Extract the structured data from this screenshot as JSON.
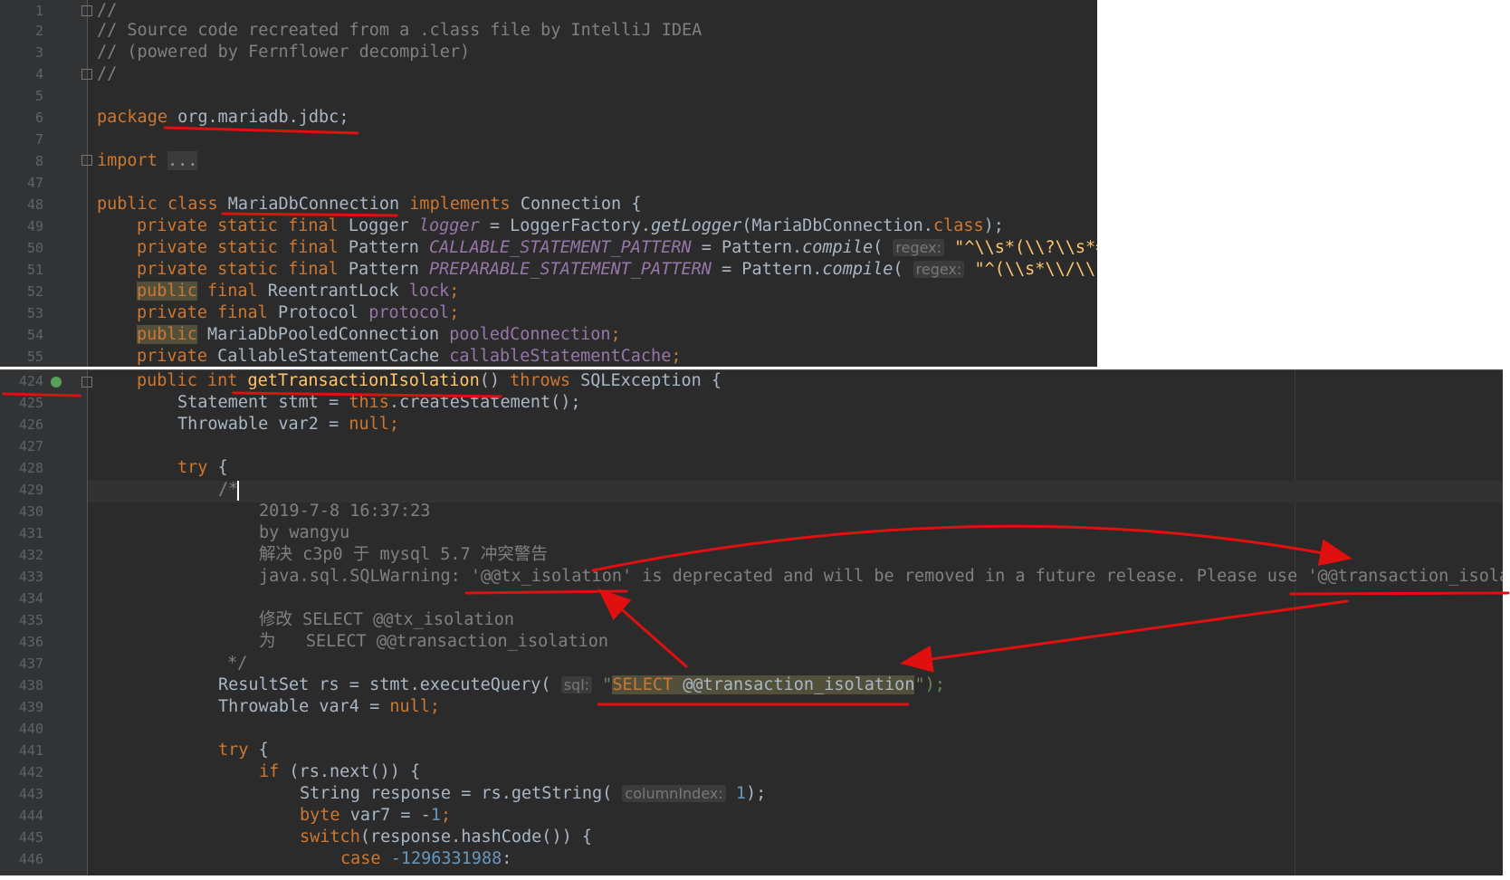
{
  "top_panel": {
    "lines": [
      {
        "n": "1",
        "t": "//"
      },
      {
        "n": "2",
        "t": "// Source code recreated from a .class file by IntelliJ IDEA"
      },
      {
        "n": "3",
        "t": "// (powered by Fernflower decompiler)"
      },
      {
        "n": "4",
        "t": "//"
      },
      {
        "n": "5",
        "t": ""
      },
      {
        "n": "6",
        "kw": "package ",
        "rest": "org.mariadb.jdbc;"
      },
      {
        "n": "7",
        "t": ""
      },
      {
        "n": "8",
        "kw": "import ",
        "rest": "..."
      },
      {
        "n": "47",
        "t": ""
      },
      {
        "n": "48",
        "a": "public class ",
        "b": "MariaDbConnection",
        "c": " implements ",
        "d": "Connection {"
      },
      {
        "n": "49",
        "a": "private static final ",
        "b": "Logger ",
        "c": "logger",
        "d": " = LoggerFactory.",
        "e": "getLogger",
        "f": "(MariaDbConnection.",
        "g": "class",
        "h": ");"
      },
      {
        "n": "50",
        "a": "private static final ",
        "b": "Pattern ",
        "c": "CALLABLE_STATEMENT_PATTERN",
        "d": " = Pattern.",
        "e": "compile",
        "f": "( ",
        "hint": "regex:",
        "g": " \"^\\\\s*(\\\\?\\\\s*=)"
      },
      {
        "n": "51",
        "a": "private static final ",
        "b": "Pattern ",
        "c": "PREPARABLE_STATEMENT_PATTERN",
        "d": " = Pattern.",
        "e": "compile",
        "f": "( ",
        "hint": "regex:",
        "g": " \"^(\\\\s*\\\\/\\\\*("
      },
      {
        "n": "52",
        "a": "public",
        "b": " final ",
        "c": "ReentrantLock ",
        "d": "lock",
        "e": ";"
      },
      {
        "n": "53",
        "a": "private final ",
        "c": "Protocol ",
        "d": "protocol",
        "e": ";"
      },
      {
        "n": "54",
        "a": "public",
        "c": " MariaDbPooledConnection ",
        "d": "pooledConnection",
        "e": ";"
      },
      {
        "n": "55",
        "a": "private ",
        "c": "CallableStatementCache ",
        "d": "callableStatementCache",
        "e": ";"
      }
    ]
  },
  "bottom_panel": {
    "lines": [
      {
        "n": "424"
      },
      {
        "n": "425"
      },
      {
        "n": "426"
      },
      {
        "n": "427"
      },
      {
        "n": "428"
      },
      {
        "n": "429"
      },
      {
        "n": "430"
      },
      {
        "n": "431"
      },
      {
        "n": "432"
      },
      {
        "n": "433"
      },
      {
        "n": "434"
      },
      {
        "n": "435"
      },
      {
        "n": "436"
      },
      {
        "n": "437"
      },
      {
        "n": "438"
      },
      {
        "n": "439"
      },
      {
        "n": "440"
      },
      {
        "n": "441"
      },
      {
        "n": "442"
      },
      {
        "n": "443"
      },
      {
        "n": "444"
      },
      {
        "n": "445"
      },
      {
        "n": "446"
      }
    ],
    "code": {
      "l424": {
        "a": "public int ",
        "b": "getTransactionIsolation",
        "c": "() ",
        "d": "throws ",
        "e": "SQLException {"
      },
      "l425": {
        "a": "Statement stmt = ",
        "b": "this",
        "c": ".createStatement();"
      },
      "l426": {
        "a": "Throwable var2 = ",
        "b": "null",
        "c": ";"
      },
      "l428": {
        "a": "try ",
        "b": "{"
      },
      "l429": "/*",
      "l430": "2019-7-8 16:37:23",
      "l431": "by wangyu",
      "l432": "解决 c3p0 于 mysql 5.7 冲突警告",
      "l433": "java.sql.SQLWarning: '@@tx_isolation' is deprecated and will be removed in a future release. Please use '@@transaction_isolat",
      "l435": "修改 SELECT @@tx_isolation",
      "l436": "为   SELECT @@transaction_isolation",
      "l437": "*/",
      "l438": {
        "a": "ResultSet rs = stmt.executeQuery( ",
        "hint": "sql:",
        "b": " \"",
        "c": "SELECT",
        "d": " @@transaction_isolation",
        "e": "\");"
      },
      "l439": {
        "a": "Throwable var4 = ",
        "b": "null",
        "c": ";"
      },
      "l441": {
        "a": "try ",
        "b": "{"
      },
      "l442": {
        "a": "if ",
        "b": "(rs.next()) {"
      },
      "l443": {
        "a": "String response = rs.getString( ",
        "hint": "columnIndex:",
        "b": " 1",
        "c": ");"
      },
      "l444": {
        "a": "byte ",
        "b": "var7 = -",
        "c": "1",
        "d": ";"
      },
      "l445": {
        "a": "switch",
        "b": "(response.hashCode()) {"
      },
      "l446": {
        "a": "case ",
        "b": "-1296331988",
        ":": ":"
      }
    }
  },
  "colors": {
    "annotation_red": "#e01010",
    "editor_bg": "#2b2b2b"
  },
  "icons": [
    "fold-icon",
    "override-marker-icon"
  ]
}
